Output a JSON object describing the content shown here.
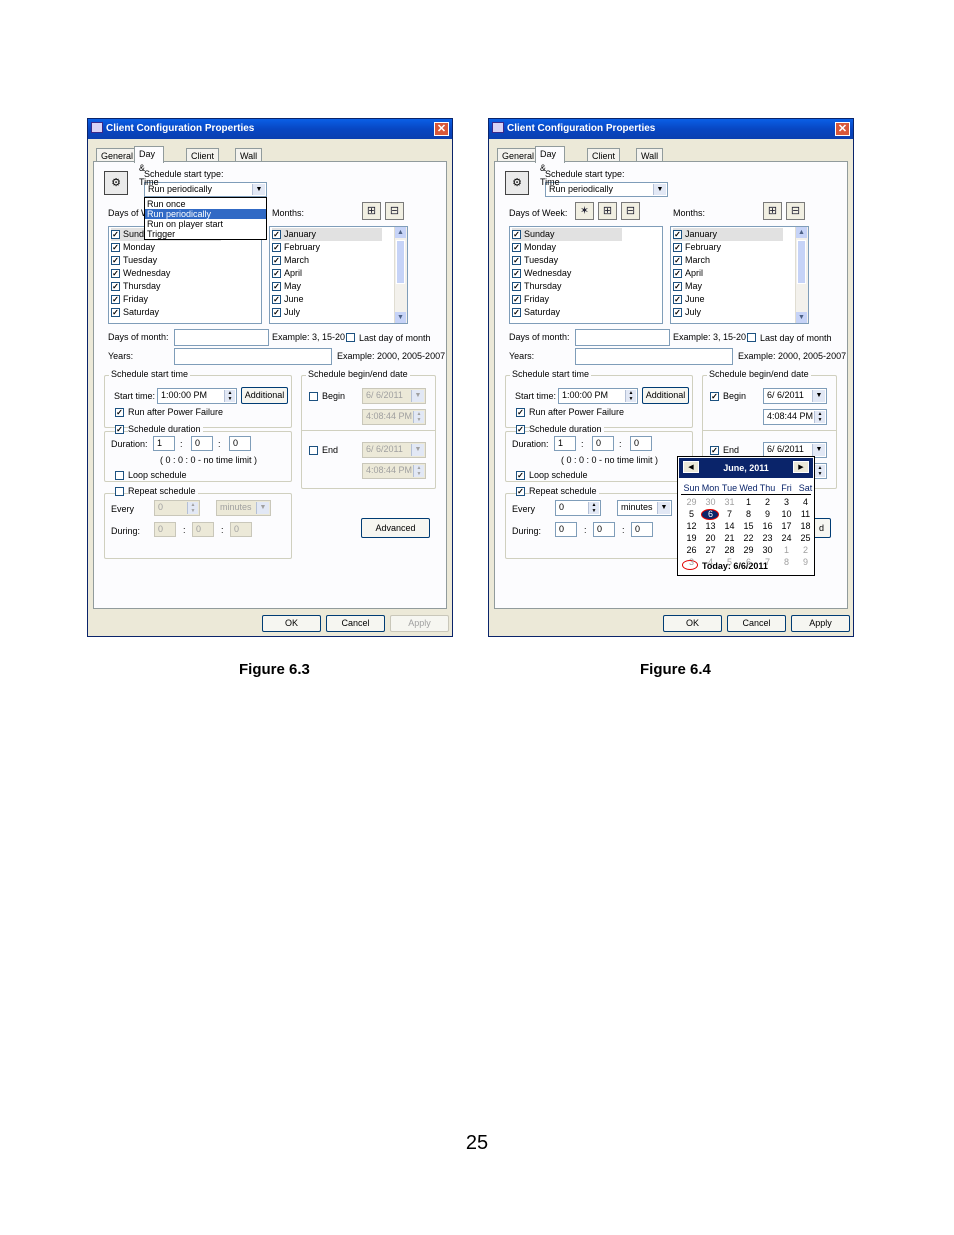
{
  "window_title": "Client Configuration Properties",
  "close_glyph": "✕",
  "tabs": [
    "General",
    "Day & Time",
    "Client Filter",
    "Wall"
  ],
  "labels": {
    "schedule_start_type": "Schedule start type:",
    "days_of_week": "Days of Week:",
    "days_of_week_partial": "Days of W",
    "months": "Months:",
    "days_of_month": "Days of month:",
    "days_of_month_example": "Example: 3, 15-20",
    "last_day_of_month": "Last day of month",
    "years": "Years:",
    "years_example": "Example: 2000, 2005-2007",
    "schedule_start_time": "Schedule start time",
    "start_time": "Start time:",
    "run_after_power_failure": "Run after Power Failure",
    "schedule_duration": "Schedule duration",
    "duration": "Duration:",
    "no_time_limit": "( 0 : 0 : 0 - no time limit )",
    "loop_schedule": "Loop schedule",
    "repeat_schedule": "Repeat schedule",
    "every": "Every",
    "during": "During:",
    "schedule_begin_end_date": "Schedule begin/end date",
    "begin": "Begin",
    "end": "End",
    "colon": ":"
  },
  "buttons": {
    "additional": "Additional",
    "advanced": "Advanced",
    "advanced_partial": "d",
    "ok": "OK",
    "cancel": "Cancel",
    "apply": "Apply"
  },
  "start_type_value": "Run periodically",
  "start_type_options": [
    "Run once",
    "Run periodically",
    "Run on player start",
    "Trigger"
  ],
  "days": [
    "Sunday",
    "Monday",
    "Tuesday",
    "Wednesday",
    "Thursday",
    "Friday",
    "Saturday"
  ],
  "days_partial_first": "Sund",
  "months_list": [
    "January",
    "February",
    "March",
    "April",
    "May",
    "June",
    "July"
  ],
  "start_time_value": "1:00:00 PM",
  "duration_values": [
    "1",
    "0",
    "0"
  ],
  "every_value_fig3": "0",
  "every_value_fig4": "0",
  "every_unit": "minutes",
  "during_values": [
    "0",
    "0",
    "0"
  ],
  "begin_date": "6/ 6/2011",
  "begin_time": "4:08:44 PM",
  "end_date": "6/ 6/2011",
  "end_time_partial": "4:08:44 PM",
  "calendar": {
    "month_title": "June, 2011",
    "weekdays": [
      "Sun",
      "Mon",
      "Tue",
      "Wed",
      "Thu",
      "Fri",
      "Sat"
    ],
    "weeks": [
      [
        "29",
        "30",
        "31",
        "1",
        "2",
        "3",
        "4"
      ],
      [
        "5",
        "6",
        "7",
        "8",
        "9",
        "10",
        "11"
      ],
      [
        "12",
        "13",
        "14",
        "15",
        "16",
        "17",
        "18"
      ],
      [
        "19",
        "20",
        "21",
        "22",
        "23",
        "24",
        "25"
      ],
      [
        "26",
        "27",
        "28",
        "29",
        "30",
        "1",
        "2"
      ],
      [
        "3",
        "4",
        "5",
        "6",
        "7",
        "8",
        "9"
      ]
    ],
    "today_label": "Today: 6/6/2011",
    "prev_glyph": "◀",
    "next_glyph": "▶"
  },
  "captions": {
    "fig3": "Figure 6.3",
    "fig4": "Figure 6.4"
  },
  "page_number": "25",
  "icons": {
    "add_all": "⊞",
    "remove_all": "⊟",
    "wand": "✶",
    "dropdown": "▼",
    "spin_up": "▲",
    "spin_down": "▼",
    "scroll_up": "▲",
    "scroll_down": "▼",
    "check": "✓",
    "app": "⚙"
  },
  "colors": {
    "title_bar": "#0846c2",
    "selection": "#316ac5",
    "calendar_header": "#0a246a"
  }
}
